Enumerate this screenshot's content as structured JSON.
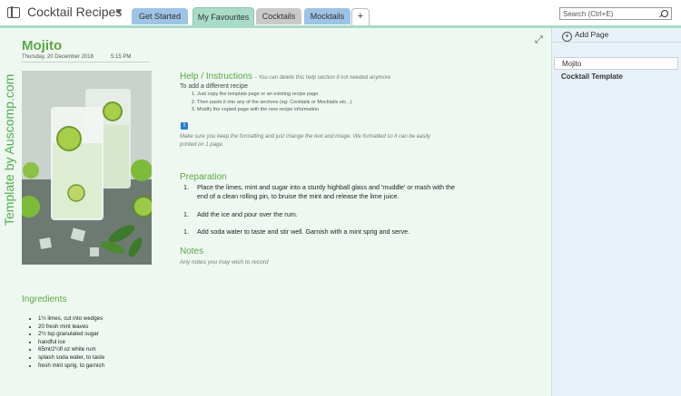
{
  "notebook": {
    "title": "Cocktail Recipes"
  },
  "tabs": [
    {
      "label": "Get Started"
    },
    {
      "label": "My Favourites"
    },
    {
      "label": "Cocktails"
    },
    {
      "label": "Mocktails"
    },
    {
      "label": "+"
    }
  ],
  "search": {
    "placeholder": "Search (Ctrl+E)"
  },
  "watermark": "Template by Auscomp.com",
  "page": {
    "title": "Mojito",
    "date": "Thursday, 20 December 2018",
    "time": "5:15 PM"
  },
  "help": {
    "heading": "Help / Instructions",
    "note": "- You can delete this help section if not needed anymore",
    "subheading": "To add a different recipe",
    "steps": [
      "Just copy the template page or an existing recipe page.",
      "Then paste it into any of the sections (eg: Cocktails or Mocktails etc...)",
      "Modify the copied page with the new recipe information"
    ],
    "info_line1": "Make sure you keep the formatting and just change the text and image. We formatted so it can be easily",
    "info_line2": "printed on 1 page."
  },
  "preparation": {
    "heading": "Preparation",
    "steps": [
      {
        "num": "1.",
        "text": "Place the limes, mint and sugar into a sturdy highball glass and 'muddle' or mash with the end of a clean rolling pin, to bruise the mint and release the lime juice."
      },
      {
        "num": "1.",
        "text": "Add the ice and pour over the rum."
      },
      {
        "num": "1.",
        "text": "Add soda water to taste and stir well. Garnish with a mint sprig and serve."
      }
    ]
  },
  "notes": {
    "heading": "Notes",
    "text": "Any notes you may wish to record"
  },
  "ingredients": {
    "heading": "Ingredients",
    "items": [
      "1½ limes, cut into wedges",
      "20 fresh mint leaves",
      "2½ tsp granulated sugar",
      "handful ice",
      "65ml/2¼fl oz white rum",
      "splash soda water, to taste",
      "fresh mint sprig, to garnish"
    ]
  },
  "sidebar": {
    "add_page": "Add Page",
    "pages": [
      "Mojito",
      "Cocktail Template"
    ]
  },
  "colors": {
    "accent_green": "#5ca844",
    "tab_teal": "#a8dcc8",
    "tab_blue": "#9dc3e6",
    "page_bg": "#eef8f1"
  }
}
